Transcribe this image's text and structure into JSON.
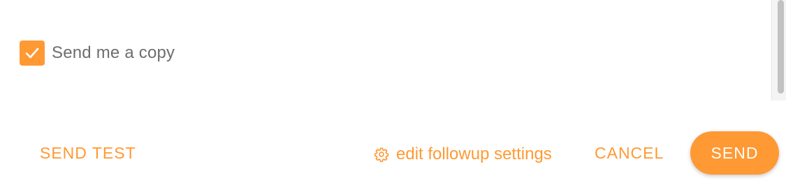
{
  "copy_option": {
    "label": "Send me a copy",
    "checked": true
  },
  "actions": {
    "send_test_label": "SEND TEST",
    "followup_label": "edit followup settings",
    "followup_icon": "gear-icon",
    "cancel_label": "CANCEL",
    "send_label": "SEND"
  },
  "colors": {
    "accent": "#ff9933",
    "label_text": "#6e6e6e"
  }
}
